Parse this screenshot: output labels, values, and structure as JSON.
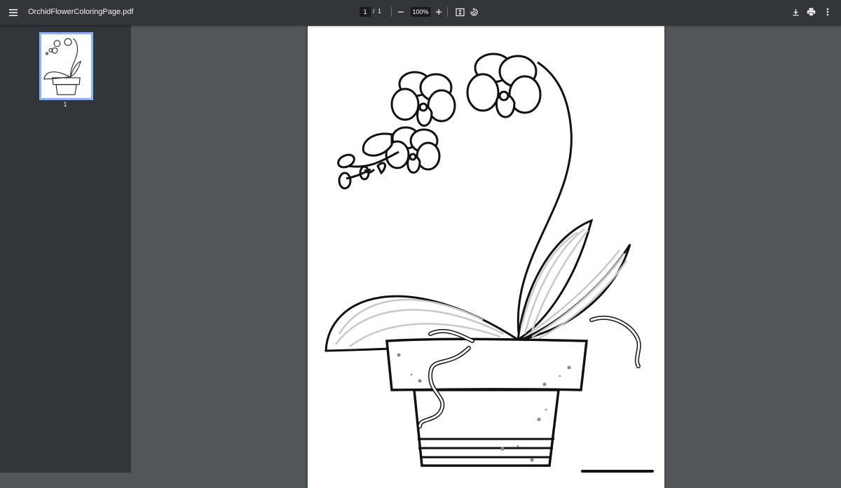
{
  "toolbar": {
    "file_title": "OrchidFlowerColoringPage.pdf",
    "current_page": "1",
    "page_separator": "/",
    "total_pages": "1",
    "zoom_level": "100%",
    "icons": [
      "menu-icon",
      "zoom-out-icon",
      "zoom-in-icon",
      "fit-page-icon",
      "rotate-icon",
      "download-icon",
      "print-icon",
      "more-options-icon"
    ]
  },
  "sidebar": {
    "thumbnails": [
      {
        "label": "1",
        "selected": true
      }
    ]
  },
  "colors": {
    "toolbar_bg": "#323639",
    "viewer_bg": "#525659",
    "thumb_selected_border": "#8ab4f8"
  }
}
